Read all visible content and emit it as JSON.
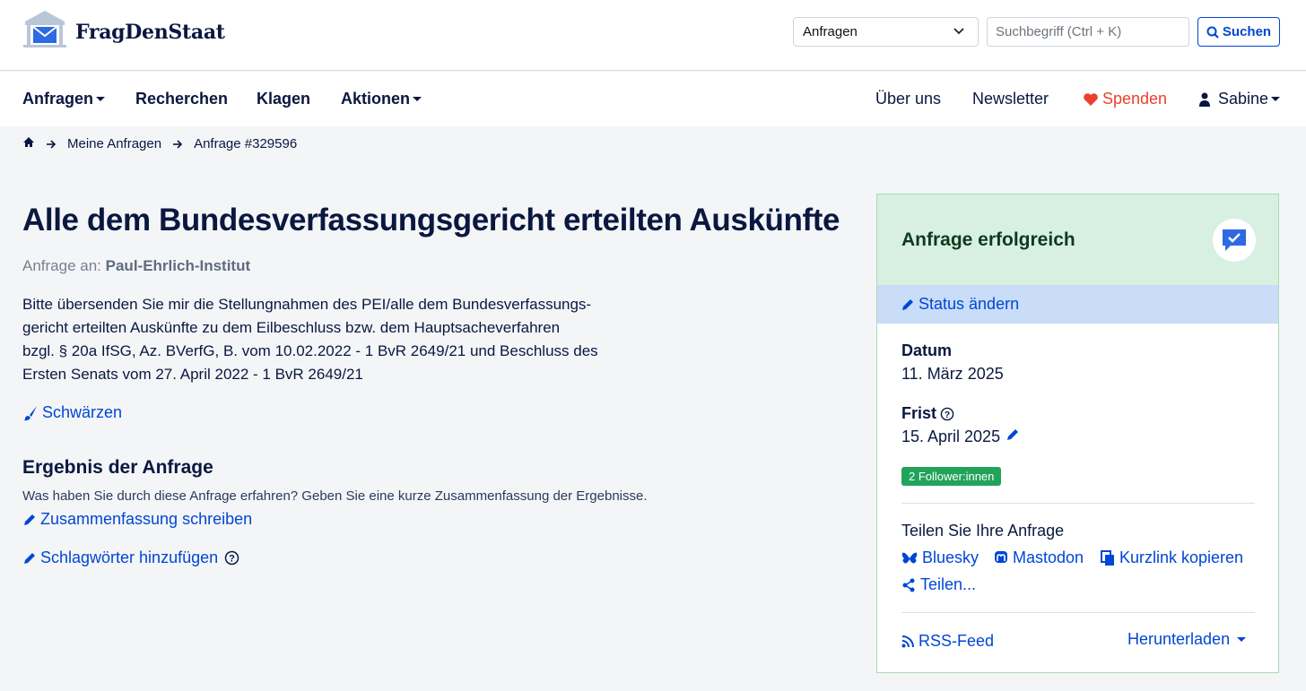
{
  "brand": {
    "name": "FragDenStaat"
  },
  "header": {
    "scope_select": "Anfragen",
    "search_placeholder": "Suchbegriff (Ctrl + K)",
    "search_button": "Suchen"
  },
  "nav": {
    "anfragen": "Anfragen",
    "recherchen": "Recherchen",
    "klagen": "Klagen",
    "aktionen": "Aktionen",
    "ueber_uns": "Über uns",
    "newsletter": "Newsletter",
    "spenden": "Spenden",
    "user": "Sabine"
  },
  "breadcrumb": {
    "items": [
      "Meine Anfragen",
      "Anfrage #329596"
    ]
  },
  "request": {
    "title": "Alle dem Bundesverfassungsgericht erteilten Auskünfte",
    "recipient_prefix": "Anfrage an:",
    "recipient": "Paul-Ehrlich-Institut",
    "body_lines": [
      "Bitte übersenden Sie mir die Stellungnahmen des PEI/alle dem Bundesverfassungs-",
      "gericht erteilten Auskünfte zu dem Eilbeschluss bzw. dem Hauptsacheverfahren",
      "bzgl. § 20a IfSG, Az. BVerfG, B. vom 10.02.2022 - 1 BvR 2649/21 und Beschluss des",
      "Ersten Senats vom 27. April 2022 - 1 BvR 2649/21"
    ],
    "redact_link": "Schwärzen"
  },
  "result": {
    "heading": "Ergebnis der Anfrage",
    "hint": "Was haben Sie durch diese Anfrage erfahren? Geben Sie eine kurze Zusammenfassung der Ergebnisse.",
    "summary_link": "Zusammenfassung schreiben",
    "tags_link": "Schlagwörter hinzufügen"
  },
  "sidebar": {
    "status_title": "Anfrage erfolgreich",
    "change_status": "Status ändern",
    "date_label": "Datum",
    "date_value": "11. März 2025",
    "deadline_label": "Frist",
    "deadline_value": "15. April 2025",
    "followers": "2 Follower:innen",
    "share_title": "Teilen Sie Ihre Anfrage",
    "share_bluesky": "Bluesky",
    "share_mastodon": "Mastodon",
    "share_shortlink": "Kurzlink kopieren",
    "share_more": "Teilen...",
    "rss": "RSS-Feed",
    "download": "Herunterladen"
  }
}
